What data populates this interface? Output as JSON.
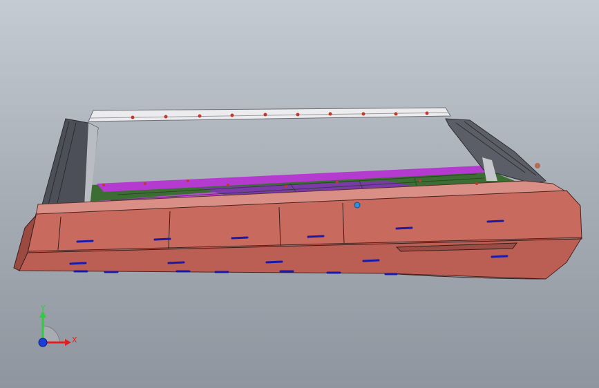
{
  "viewport": {
    "background_top": "#c5cbd3",
    "background_bottom": "#8f959e"
  },
  "model": {
    "body_color": "#c96a5f",
    "body_dark_color": "#a95248",
    "frame_color": "#e8e8ea",
    "fastener_color": "#c0392b",
    "marker_color": "#1a1aa8",
    "inner_magenta": "#c13fd6",
    "inner_green": "#2f6b2f",
    "column_color": "#4a4d55"
  },
  "triad": {
    "y_label": "Y",
    "x_label": "X",
    "y_color": "#2ecc40",
    "x_color": "#e02020",
    "z_color": "#1a3fd8"
  }
}
